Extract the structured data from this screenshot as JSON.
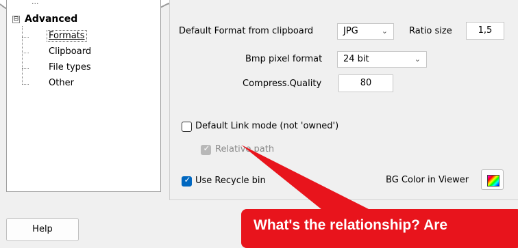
{
  "tree": {
    "expander": "⊟",
    "clipped_item": "...",
    "items": [
      {
        "label": "Advanced"
      },
      {
        "label": "Formats"
      },
      {
        "label": "Clipboard"
      },
      {
        "label": "File types"
      },
      {
        "label": "Other"
      }
    ]
  },
  "settings": {
    "default_format_label": "Default Format from clipboard",
    "default_format_value": "JPG",
    "ratio_label": "Ratio size",
    "ratio_value": "1,5",
    "bmp_label": "Bmp pixel format",
    "bmp_value": "24 bit",
    "quality_label": "Compress.Quality",
    "quality_value": "80",
    "link_mode_label": "Default Link mode (not 'owned')",
    "link_mode_checked": false,
    "relative_label": "Relative path",
    "relative_checked": true,
    "recycle_label": "Use Recycle bin",
    "recycle_checked": true,
    "bg_color_label": "BG Color in Viewer"
  },
  "footer": {
    "help_label": "Help"
  },
  "callout": {
    "text": "What's the relationship? Are",
    "color": "#e8141c"
  },
  "colors": {
    "accent": "#0067c0",
    "window_bg": "#f0f0f0"
  }
}
